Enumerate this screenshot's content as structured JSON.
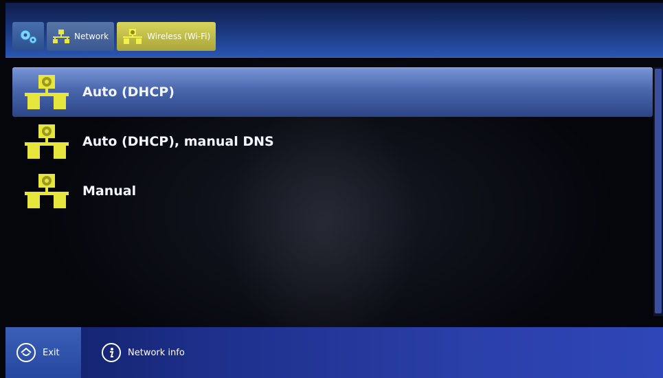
{
  "breadcrumbs": {
    "settings_icon": "gears-icon",
    "network_label": "Network",
    "wifi_label": "Wireless (Wi-Fi)"
  },
  "options": [
    {
      "label": "Auto (DHCP)",
      "icon": "network-config-icon",
      "selected": true
    },
    {
      "label": "Auto (DHCP), manual DNS",
      "icon": "network-config-icon",
      "selected": false
    },
    {
      "label": "Manual",
      "icon": "network-config-icon",
      "selected": false
    }
  ],
  "footer": {
    "exit_label": "Exit",
    "info_label": "Network info"
  },
  "colors": {
    "accent_yellow": "#d4d43a",
    "selection_blue": "#4a67ad",
    "bar_blue": "#1d2f8a"
  }
}
